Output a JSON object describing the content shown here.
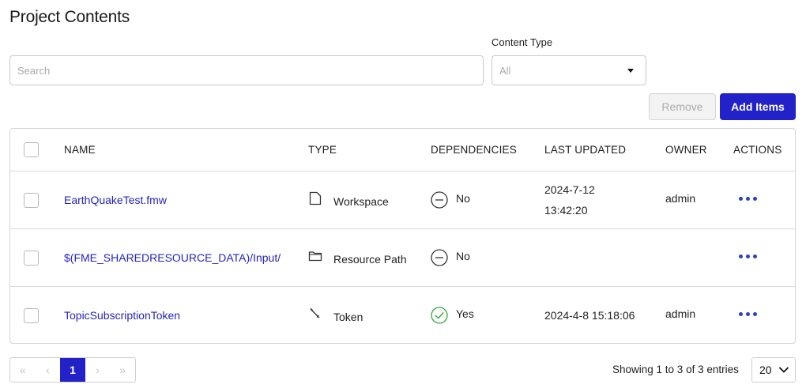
{
  "page": {
    "title": "Project Contents"
  },
  "search": {
    "placeholder": "Search",
    "value": ""
  },
  "filter": {
    "label": "Content Type",
    "selected": "All"
  },
  "toolbar": {
    "remove_label": "Remove",
    "add_label": "Add Items"
  },
  "table": {
    "headers": {
      "name": "NAME",
      "type": "TYPE",
      "dependencies": "DEPENDENCIES",
      "last_updated": "LAST UPDATED",
      "owner": "OWNER",
      "actions": "ACTIONS"
    },
    "rows": [
      {
        "name": "EarthQuakeTest.fmw",
        "type": "Workspace",
        "type_icon": "file-icon",
        "dependencies": "No",
        "dep_icon": "minus-circle-icon",
        "last_updated": "2024-7-12\n13:42:20",
        "owner": "admin"
      },
      {
        "name": "$(FME_SHAREDRESOURCE_DATA)/Input/",
        "type": "Resource Path",
        "type_icon": "folder-icon",
        "dependencies": "No",
        "dep_icon": "minus-circle-icon",
        "last_updated": "",
        "owner": ""
      },
      {
        "name": "TopicSubscriptionToken",
        "type": "Token",
        "type_icon": "key-icon",
        "dependencies": "Yes",
        "dep_icon": "check-circle-icon",
        "last_updated": "2024-4-8 15:18:06",
        "owner": "admin"
      }
    ]
  },
  "pagination": {
    "first_label": "«",
    "prev_label": "‹",
    "current_page": "1",
    "next_label": "›",
    "last_label": "»",
    "showing_text": "Showing 1 to 3 of 3 entries",
    "page_size": "20"
  },
  "colors": {
    "accent": "#2222c8",
    "link": "#2424c4",
    "dots": "#2d3fc7",
    "success": "#2ea836"
  }
}
